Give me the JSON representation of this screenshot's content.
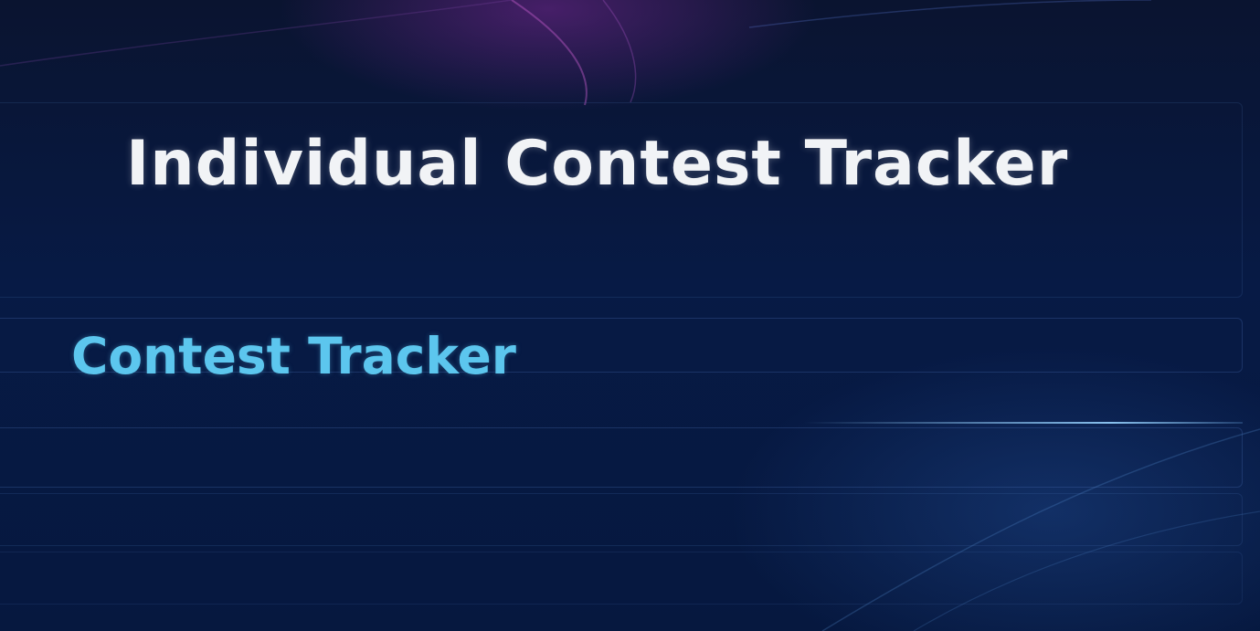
{
  "page": {
    "title": "Individual Contest Tracker",
    "subtitle": "Contest Tracker"
  },
  "colors": {
    "background": "#071638",
    "title": "#f1f3f6",
    "subtitle": "#5cc6ee",
    "accent_glow": "#7a2896"
  }
}
